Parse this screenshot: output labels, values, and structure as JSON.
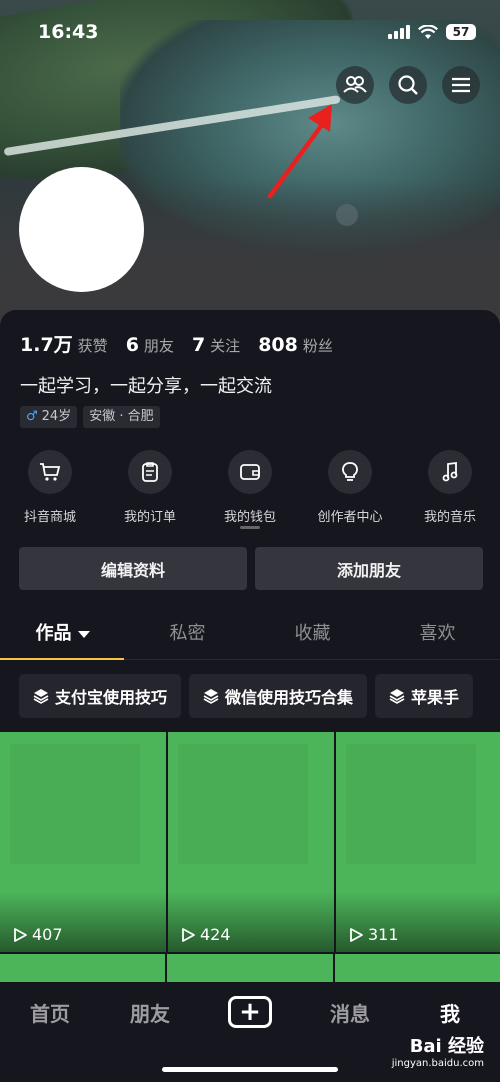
{
  "status_bar": {
    "time": "16:43",
    "battery": "57"
  },
  "stats": [
    {
      "value": "1.7万",
      "label": "获赞"
    },
    {
      "value": "6",
      "label": "朋友"
    },
    {
      "value": "7",
      "label": "关注"
    },
    {
      "value": "808",
      "label": "粉丝"
    }
  ],
  "bio": "一起学习，一起分享，一起交流",
  "tags": {
    "gender_icon": "♂",
    "age": "24岁",
    "location": "安徽 · 合肥"
  },
  "shortcuts": [
    {
      "label": "抖音商城",
      "icon": "cart-icon"
    },
    {
      "label": "我的订单",
      "icon": "order-icon"
    },
    {
      "label": "我的钱包",
      "icon": "wallet-icon"
    },
    {
      "label": "创作者中心",
      "icon": "bulb-icon"
    },
    {
      "label": "我的音乐",
      "icon": "music-icon"
    }
  ],
  "actions": {
    "edit_profile": "编辑资料",
    "add_friend": "添加朋友"
  },
  "tabs": [
    "作品",
    "私密",
    "收藏",
    "喜欢"
  ],
  "collections": [
    "支付宝使用技巧",
    "微信使用技巧合集",
    "苹果手"
  ],
  "videos": [
    {
      "views": "407"
    },
    {
      "views": "424"
    },
    {
      "views": "311"
    }
  ],
  "bottom_nav": {
    "home": "首页",
    "friends": "朋友",
    "messages": "消息",
    "me": "我"
  },
  "watermark": {
    "brand": "Bai 经验",
    "url": "jingyan.baidu.com"
  },
  "colors": {
    "accent_underline": "#f6c344",
    "video_bg": "#4cb55a",
    "annotation_arrow": "#e8211f"
  }
}
